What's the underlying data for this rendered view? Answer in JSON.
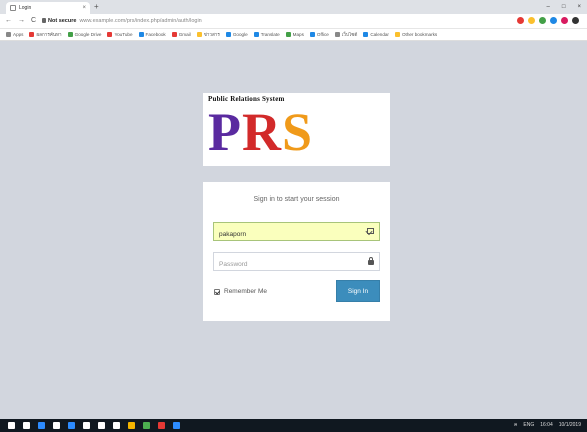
{
  "browser": {
    "tab_title": "Login",
    "tab_close": "×",
    "new_tab": "+",
    "window_controls": [
      "–",
      "□",
      "×"
    ],
    "nav": [
      "←",
      "→",
      "C"
    ],
    "address_host": "Not secure",
    "address_path": "www.example.com/prs/index.php/admin/auth/login",
    "extension_colors": [
      "#e53935",
      "#fbc02d",
      "#43a047",
      "#1e88e5",
      "#d81b60",
      "#333333"
    ]
  },
  "bookmarks": [
    {
      "label": "Apps",
      "color": "#888888"
    },
    {
      "label": "ผลการค้นหา",
      "color": "#e53935"
    },
    {
      "label": "Google Drive",
      "color": "#43a047"
    },
    {
      "label": "YouTube",
      "color": "#e53935"
    },
    {
      "label": "Facebook",
      "color": "#1e88e5"
    },
    {
      "label": "Gmail",
      "color": "#e53935"
    },
    {
      "label": "ข่าวสาร",
      "color": "#fbc02d"
    },
    {
      "label": "Google",
      "color": "#1e88e5"
    },
    {
      "label": "Translate",
      "color": "#1e88e5"
    },
    {
      "label": "Maps",
      "color": "#43a047"
    },
    {
      "label": "Office",
      "color": "#1e88e5"
    },
    {
      "label": "เว็บไซต์",
      "color": "#888888"
    },
    {
      "label": "Calendar",
      "color": "#1e88e5"
    },
    {
      "label": "Other bookmarks",
      "color": "#fbc02d"
    }
  ],
  "logo": {
    "subtitle": "Public Relations System",
    "letters": [
      "P",
      "R",
      "S"
    ]
  },
  "login": {
    "message": "Sign in to start your session",
    "username_value": "pakaporn",
    "password_placeholder": "Password",
    "remember_label": "Remember Me",
    "signin_label": "Sign In"
  },
  "taskbar": {
    "icon_colors": [
      "#ffffff",
      "#ffffff",
      "#2d8cff",
      "#ffffff",
      "#2d8cff",
      "#ffffff",
      "#ffffff",
      "#ffffff",
      "#f4b400",
      "#4caf50",
      "#e53935",
      "#2d8cff"
    ],
    "tray": [
      "ค",
      "ENG",
      "16:04",
      "10/1/2019"
    ]
  }
}
